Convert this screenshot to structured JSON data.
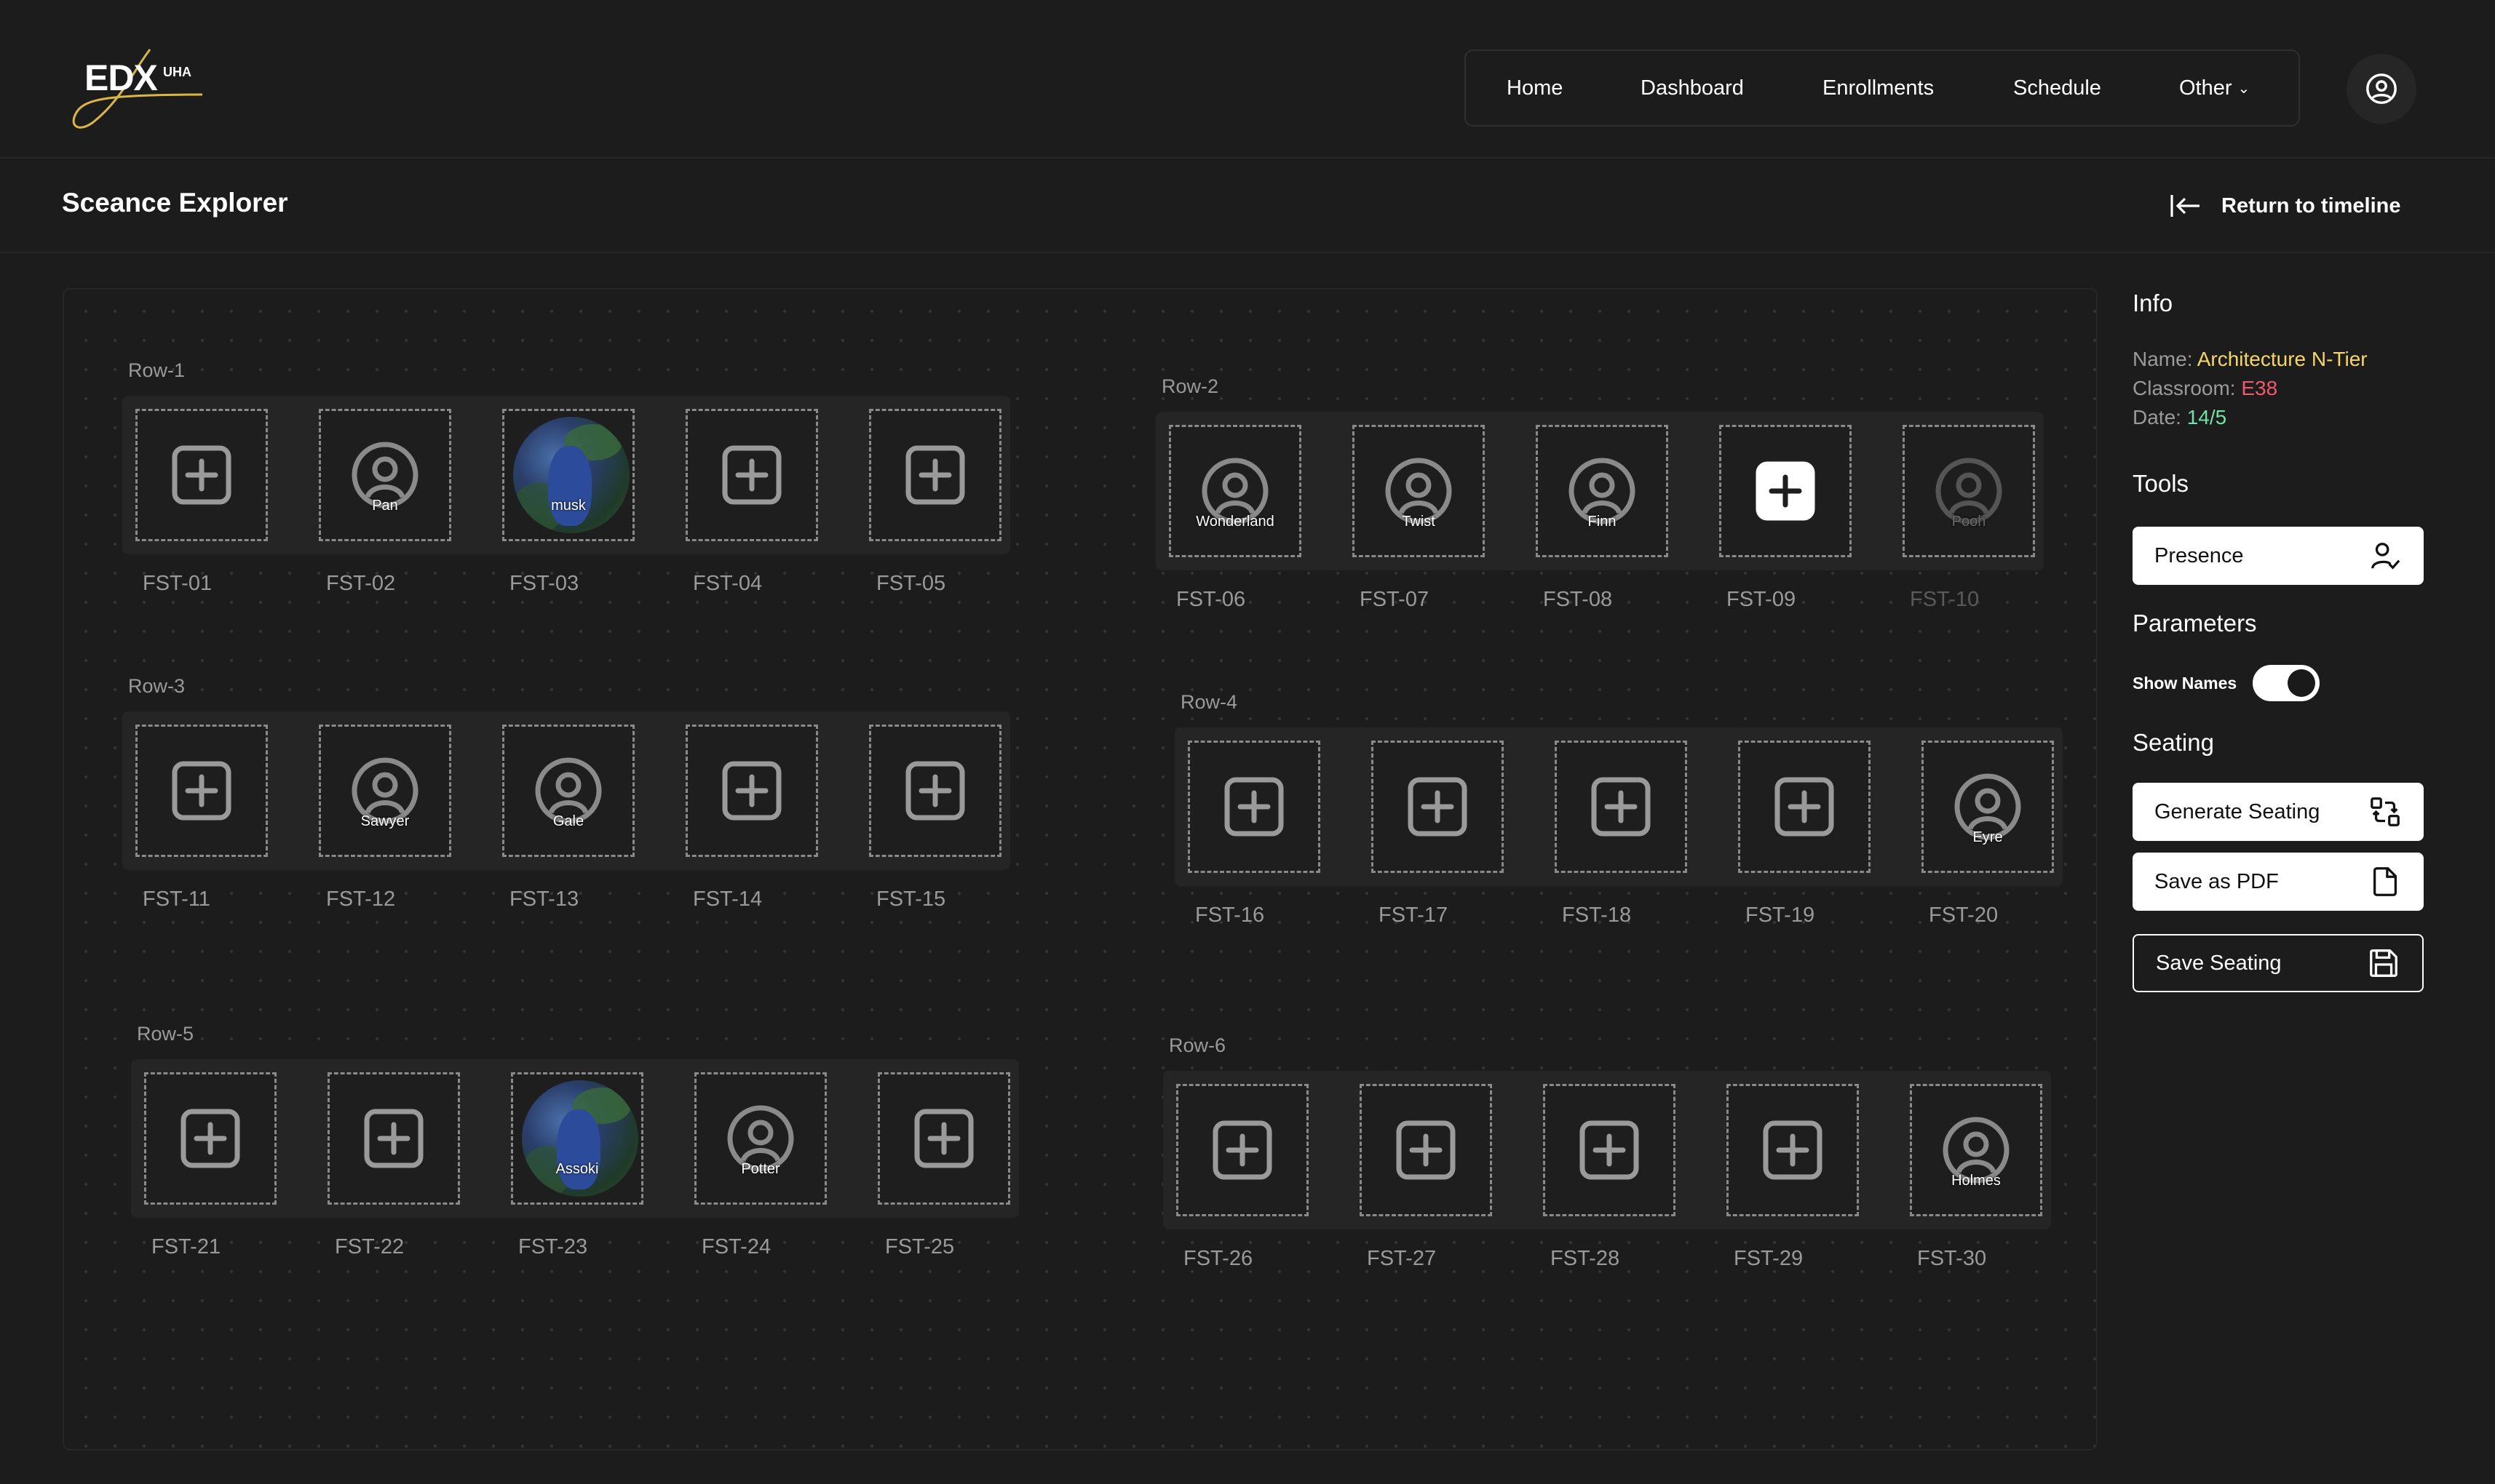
{
  "brand": {
    "logo_text": "EDX",
    "logo_sub": "UHA"
  },
  "nav": {
    "items": [
      {
        "label": "Home"
      },
      {
        "label": "Dashboard"
      },
      {
        "label": "Enrollments"
      },
      {
        "label": "Schedule"
      },
      {
        "label": "Other"
      }
    ]
  },
  "header": {
    "title": "Sceance Explorer",
    "return_label": "Return to timeline"
  },
  "rows": [
    {
      "label": "Row-1",
      "seats": [
        {
          "code": "FST-01",
          "state": "empty",
          "name": ""
        },
        {
          "code": "FST-02",
          "state": "user",
          "name": "Pan"
        },
        {
          "code": "FST-03",
          "state": "photo",
          "name": "musk"
        },
        {
          "code": "FST-04",
          "state": "empty",
          "name": ""
        },
        {
          "code": "FST-05",
          "state": "empty",
          "name": ""
        }
      ]
    },
    {
      "label": "Row-2",
      "seats": [
        {
          "code": "FST-06",
          "state": "user",
          "name": "Wonderland"
        },
        {
          "code": "FST-07",
          "state": "user",
          "name": "Twist"
        },
        {
          "code": "FST-08",
          "state": "user",
          "name": "Finn"
        },
        {
          "code": "FST-09",
          "state": "empty-active",
          "name": ""
        },
        {
          "code": "FST-10",
          "state": "user-dim",
          "name": "Pooh"
        }
      ]
    },
    {
      "label": "Row-3",
      "seats": [
        {
          "code": "FST-11",
          "state": "empty",
          "name": ""
        },
        {
          "code": "FST-12",
          "state": "user",
          "name": "Sawyer"
        },
        {
          "code": "FST-13",
          "state": "user",
          "name": "Gale"
        },
        {
          "code": "FST-14",
          "state": "empty",
          "name": ""
        },
        {
          "code": "FST-15",
          "state": "empty",
          "name": ""
        }
      ]
    },
    {
      "label": "Row-4",
      "seats": [
        {
          "code": "FST-16",
          "state": "empty",
          "name": ""
        },
        {
          "code": "FST-17",
          "state": "empty",
          "name": ""
        },
        {
          "code": "FST-18",
          "state": "empty",
          "name": ""
        },
        {
          "code": "FST-19",
          "state": "empty",
          "name": ""
        },
        {
          "code": "FST-20",
          "state": "user",
          "name": "Eyre"
        }
      ]
    },
    {
      "label": "Row-5",
      "seats": [
        {
          "code": "FST-21",
          "state": "empty",
          "name": ""
        },
        {
          "code": "FST-22",
          "state": "empty",
          "name": ""
        },
        {
          "code": "FST-23",
          "state": "photo",
          "name": "Assoki"
        },
        {
          "code": "FST-24",
          "state": "user",
          "name": "Potter"
        },
        {
          "code": "FST-25",
          "state": "empty",
          "name": ""
        }
      ]
    },
    {
      "label": "Row-6",
      "seats": [
        {
          "code": "FST-26",
          "state": "empty",
          "name": ""
        },
        {
          "code": "FST-27",
          "state": "empty",
          "name": ""
        },
        {
          "code": "FST-28",
          "state": "empty",
          "name": ""
        },
        {
          "code": "FST-29",
          "state": "empty",
          "name": ""
        },
        {
          "code": "FST-30",
          "state": "user",
          "name": "Holmes"
        }
      ]
    }
  ],
  "sidebar": {
    "info_heading": "Info",
    "name_label": "Name:",
    "name_value": "Architecture N-Tier",
    "classroom_label": "Classroom:",
    "classroom_value": "E38",
    "date_label": "Date:",
    "date_value": "14/5",
    "tools_heading": "Tools",
    "presence_label": "Presence",
    "parameters_heading": "Parameters",
    "show_names_label": "Show Names",
    "show_names_on": true,
    "seating_heading": "Seating",
    "generate_label": "Generate Seating",
    "pdf_label": "Save as PDF",
    "save_label": "Save Seating"
  },
  "colors": {
    "background": "#1c1c1c",
    "accent_yellow": "#f5d66a",
    "accent_red": "#f05a6e",
    "accent_green": "#74e0a6"
  },
  "icons": {
    "add_seat": "plus-square-icon",
    "occupied_seat": "user-circle-icon",
    "profile": "user-circle-icon",
    "return": "arrow-left-to-line-icon",
    "presence": "user-check-icon",
    "generate": "shuffle-squares-icon",
    "pdf": "file-icon",
    "save": "floppy-disk-icon"
  }
}
